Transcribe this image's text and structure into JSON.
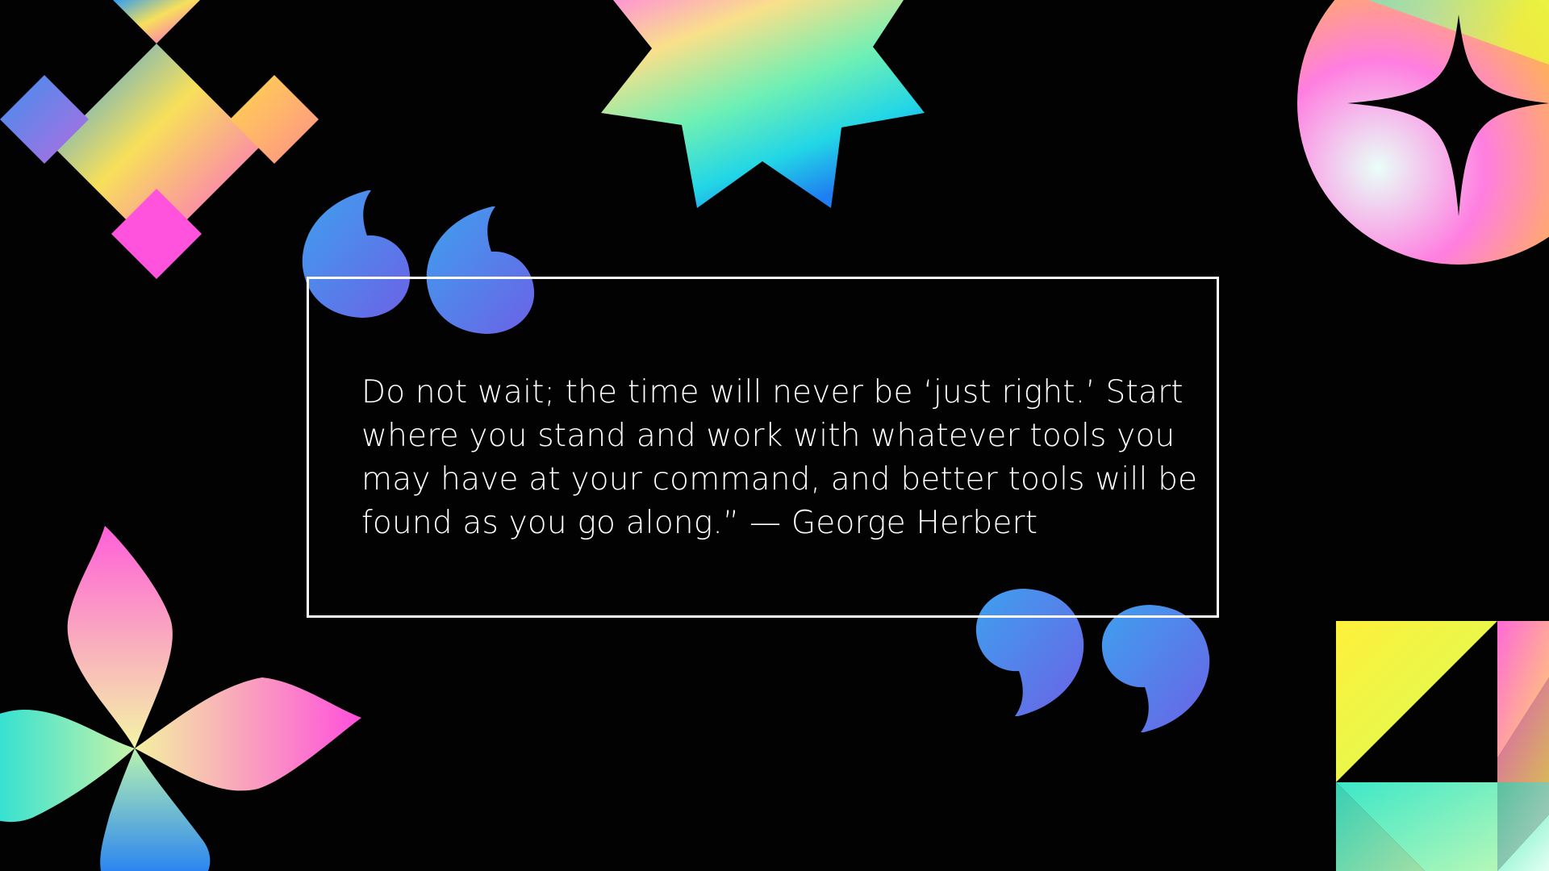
{
  "slide": {
    "background": "#020202",
    "quote": "Do not wait; the time will never be ‘just right.’ Start where you stand and work with whatever tools you may have at your command, and better tools will be found as you go along.” — George Herbert"
  },
  "gradient": {
    "blue": "#3b9cf0",
    "purple": "#7a6ce8",
    "pink": "#ff52dd",
    "yellow": "#ffe640",
    "green": "#a6f5a8",
    "cyan": "#27e2dc",
    "mint": "#c9fbe6"
  },
  "decor": [
    "diamond-cross-icon",
    "starburst-icon",
    "circle-sparkle-icon",
    "pinwheel-petal-icon",
    "triangle-tiles-icon",
    "open-quote-mark-icon",
    "close-quote-mark-icon"
  ]
}
